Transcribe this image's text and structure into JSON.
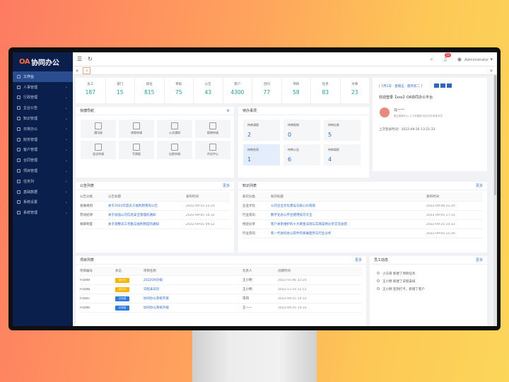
{
  "app": {
    "logo_prefix": "OA",
    "logo_text": "协同办公"
  },
  "sidebar": {
    "items": [
      {
        "label": "工作台",
        "icon": "home-icon",
        "active": true
      },
      {
        "label": "人事管理",
        "icon": "user-icon"
      },
      {
        "label": "行政管理",
        "icon": "briefcase-icon"
      },
      {
        "label": "企业公告",
        "icon": "megaphone-icon"
      },
      {
        "label": "知识管理",
        "icon": "book-icon"
      },
      {
        "label": "日常办公",
        "icon": "calendar-icon"
      },
      {
        "label": "财务管理",
        "icon": "money-icon"
      },
      {
        "label": "客户管理",
        "icon": "customer-icon"
      },
      {
        "label": "合同管理",
        "icon": "contract-icon"
      },
      {
        "label": "项目管理",
        "icon": "project-icon"
      },
      {
        "label": "任务列",
        "icon": "task-icon"
      },
      {
        "label": "基础数据",
        "icon": "database-icon"
      },
      {
        "label": "系统设置",
        "icon": "gear-icon"
      },
      {
        "label": "系统管理",
        "icon": "shield-icon"
      }
    ]
  },
  "topbar": {
    "user": "Administrator",
    "notif_count": "25"
  },
  "stats": [
    {
      "label": "员工",
      "value": "187"
    },
    {
      "label": "部门",
      "value": "15"
    },
    {
      "label": "岗位",
      "value": "815"
    },
    {
      "label": "审批",
      "value": "75"
    },
    {
      "label": "公告",
      "value": "43"
    },
    {
      "label": "客户",
      "value": "4300"
    },
    {
      "label": "合同",
      "value": "77"
    },
    {
      "label": "项目",
      "value": "58"
    },
    {
      "label": "任务",
      "value": "83"
    },
    {
      "label": "文章",
      "value": "23"
    }
  ],
  "calendar": {
    "date": "[ 7月1日 · 星期五 · 腊月初二 ]",
    "welcome": "欢迎登录【xxx】OA协同办公平台",
    "name": "马一一",
    "dept": "整合营销中心-人力资源部-岗位评价考核专员",
    "last_login": "上次登录时间：2022-09-26 13:21:33"
  },
  "quick": {
    "title": "快捷导航",
    "items": [
      "通讯录",
      "休假申请",
      "公文通知",
      "报销申请",
      "会议申请",
      "写周报",
      "出差申请",
      "评论中心"
    ]
  },
  "todo": {
    "title": "待办事项",
    "items": [
      {
        "label": "待审请假",
        "value": "2"
      },
      {
        "label": "待审报销",
        "value": "0"
      },
      {
        "label": "待审出差",
        "value": "5"
      },
      {
        "label": "待审合同",
        "value": "1"
      },
      {
        "label": "待审公告",
        "value": "6"
      },
      {
        "label": "待审离职",
        "value": "4"
      }
    ]
  },
  "notices": {
    "title": "公告列表",
    "more": "更多",
    "headers": [
      "公告分类",
      "公告标题",
      "发布时间"
    ],
    "rows": [
      {
        "cat": "发展规划",
        "title": "关于2022年度员工福利政策的公告",
        "time": "2022-09-10 22:20"
      },
      {
        "cat": "劳动纪律",
        "title": "关于加强公司信息安全管理的通知",
        "time": "2022-09-05 14:32"
      },
      {
        "cat": "规章制度",
        "title": "关于调整员工考勤与福利制度的通知",
        "time": "2022-09-01 09:12"
      }
    ]
  },
  "knowledge": {
    "title": "知识列表",
    "more": "更多",
    "headers": [
      "知识分类",
      "知识标题",
      "发布时间"
    ],
    "rows": [
      {
        "cat": "企业文化",
        "title": "公司企业文化建设与核心价值观",
        "time": "2022-09-08 22:20"
      },
      {
        "cat": "行业资讯",
        "title": "数字化办公平台使用技巧大全",
        "time": "2022-09-05 17:31"
      },
      {
        "cat": "经验分享",
        "title": "客户关系维护的十大黄金法则与实践案例分享交流总结",
        "time": "2022-09-25 14:33"
      },
      {
        "cat": "行业资讯",
        "title": "新一代协同办公软件的发展趋势与行业分析",
        "time": "2022-09-05 15:30"
      }
    ]
  },
  "projects": {
    "title": "项目列表",
    "more": "更多",
    "headers": [
      "项目编号",
      "状态",
      "项目名称",
      "负责人",
      "创建时间"
    ],
    "rows": [
      {
        "id": "P1009",
        "status": "进行中",
        "color": "#f5b500",
        "name": "2022OA升级",
        "owner": "王小明",
        "time": "2022-01-06 22:20"
      },
      {
        "id": "P1008",
        "status": "进行中",
        "color": "#f5b500",
        "name": "日程表日历",
        "owner": "王小明",
        "time": "2022-12-10 22:51"
      },
      {
        "id": "P1007",
        "status": "已完成",
        "color": "#2d7bdf",
        "name": "协同办公系统开发",
        "owner": "李四",
        "time": "2022-09-25 14:33"
      },
      {
        "id": "P1006",
        "status": "已完成",
        "color": "#2d7bdf",
        "name": "协同办公系统升级",
        "owner": "王一一",
        "time": "2022-09-25 14:33"
      }
    ]
  },
  "timeline": {
    "title": "员工动态",
    "more": "更多",
    "items": [
      "小马哥 新建了项目任务",
      "王小明 新建了日程安排",
      "王小明 签到打卡，新增了客户"
    ]
  }
}
